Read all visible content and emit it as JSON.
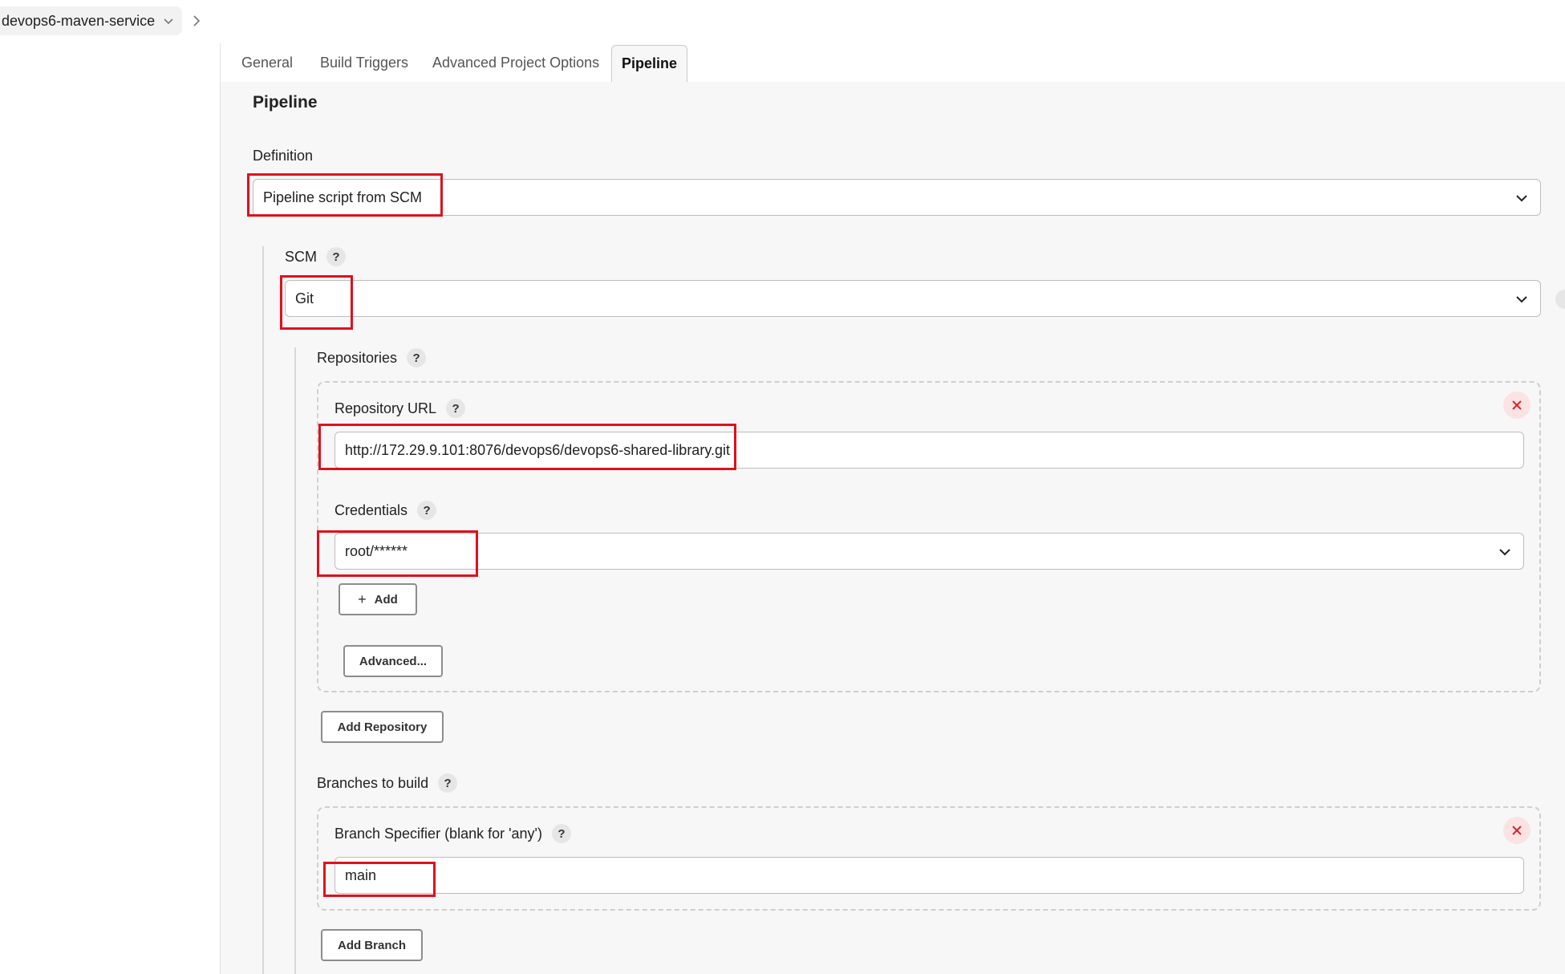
{
  "breadcrumb": {
    "project": "devops6-maven-service"
  },
  "tabs": [
    {
      "label": "General"
    },
    {
      "label": "Build Triggers"
    },
    {
      "label": "Advanced Project Options"
    },
    {
      "label": "Pipeline"
    }
  ],
  "pipeline": {
    "title": "Pipeline",
    "definition_label": "Definition",
    "definition_value": "Pipeline script from SCM",
    "scm_label": "SCM",
    "scm_value": "Git",
    "repositories_label": "Repositories",
    "repo_url_label": "Repository URL",
    "repo_url_value": "http://172.29.9.101:8076/devops6/devops6-shared-library.git",
    "credentials_label": "Credentials",
    "credentials_value": "root/******",
    "add_label": "Add",
    "advanced_label": "Advanced...",
    "add_repository_label": "Add Repository",
    "branches_label": "Branches to build",
    "branch_spec_label": "Branch Specifier (blank for 'any')",
    "branch_spec_value": "main",
    "add_branch_label": "Add Branch"
  },
  "help_glyph": "?",
  "colors": {
    "highlight": "#e0101e",
    "close": "#d9232e"
  }
}
